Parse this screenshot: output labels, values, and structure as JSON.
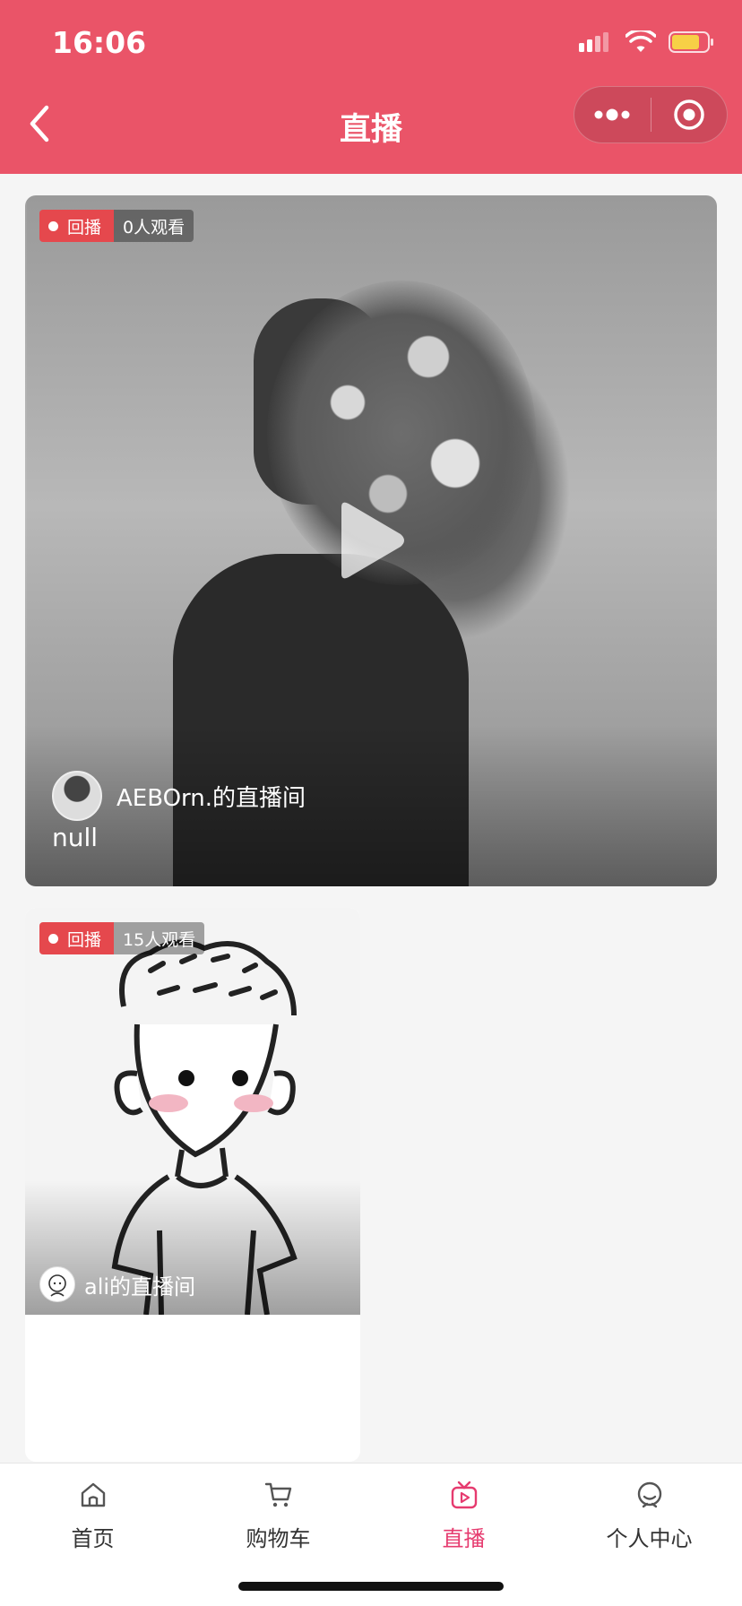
{
  "status_bar": {
    "time": "16:06"
  },
  "nav": {
    "title": "直播",
    "back_icon": "chevron-left-icon",
    "menu_icon": "more-dots-icon",
    "close_icon": "target-circle-icon"
  },
  "colors": {
    "header_bg": "#ea5468",
    "badge_red": "#e5484d",
    "tab_active": "#e63b6f"
  },
  "streams": [
    {
      "status": "回播",
      "viewers": "0人观看",
      "anchor_name": "AEBOrn.的直播间",
      "description": "null"
    },
    {
      "status": "回播",
      "viewers": "15人观看",
      "anchor_name": "ali的直播间"
    }
  ],
  "tabbar": {
    "items": [
      {
        "label": "首页",
        "icon": "home-icon"
      },
      {
        "label": "购物车",
        "icon": "cart-icon"
      },
      {
        "label": "直播",
        "icon": "live-icon",
        "active": true
      },
      {
        "label": "个人中心",
        "icon": "profile-icon"
      }
    ]
  }
}
